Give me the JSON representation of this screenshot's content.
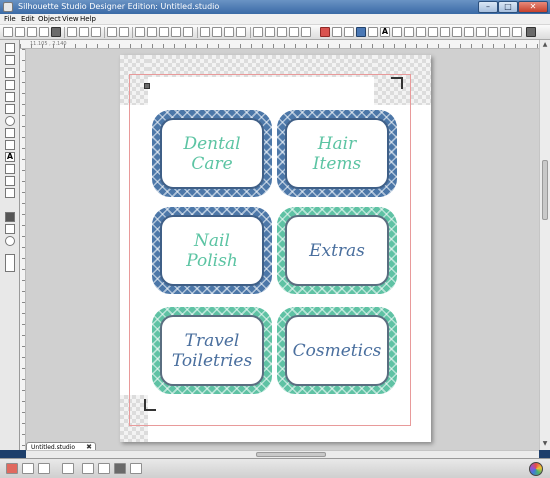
{
  "window": {
    "title": "Silhouette Studio Designer Edition: Untitled.studio",
    "minimize_glyph": "–",
    "maximize_glyph": "□",
    "close_glyph": "✕"
  },
  "menu": {
    "items": [
      "File",
      "Edit",
      "Object",
      "View",
      "Help"
    ]
  },
  "ruler": {
    "coordinates": "11.105 , 2.140"
  },
  "toolbar_icons": [
    "new-document-icon",
    "open-icon",
    "save-icon",
    "print-icon",
    "cut-send-icon",
    "cut-icon",
    "copy-icon",
    "paste-icon",
    "undo-icon",
    "redo-icon",
    "zoom-in-icon",
    "zoom-out-icon",
    "zoom-select-icon",
    "pan-icon",
    "fit-page-icon",
    "group-icon",
    "ungroup-icon",
    "fill-color-icon",
    "line-color-icon",
    "line-style-icon",
    "text-style-icon",
    "align-icon",
    "replicate-icon",
    "modify-icon",
    "trace-icon",
    "offset-icon",
    "page-setup-icon",
    "cut-settings-icon",
    "registration-icon",
    "grid-icon",
    "send-to-silhouette-icon"
  ],
  "labels": [
    {
      "text": "Dental\nCare",
      "frame": "blue",
      "text_color": "#5cc4a3"
    },
    {
      "text": "Hair\nItems",
      "frame": "blue",
      "text_color": "#5cc4a3"
    },
    {
      "text": "Nail\nPolish",
      "frame": "blue",
      "text_color": "#5cc4a3"
    },
    {
      "text": "Extras",
      "frame": "teal",
      "text_color": "#4a6f9e"
    },
    {
      "text": "Travel\nToiletries",
      "frame": "teal",
      "text_color": "#4a6f9e"
    },
    {
      "text": "Cosmetics",
      "frame": "teal",
      "text_color": "#4a6f9e"
    }
  ],
  "colors": {
    "frame_blue": "#4c77a8",
    "frame_teal": "#5fc2a4",
    "cut_border": "#e89a9a"
  },
  "tabs": [
    {
      "label": "Untitled.studio",
      "close_glyph": "✖"
    }
  ]
}
